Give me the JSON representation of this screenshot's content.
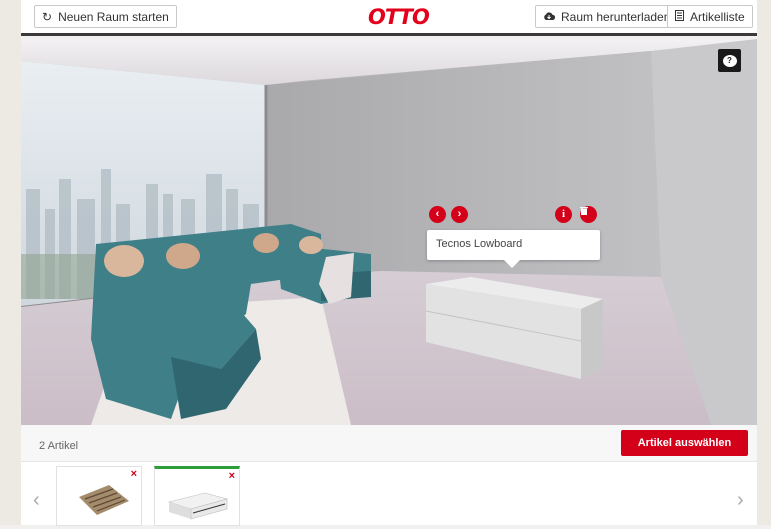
{
  "header": {
    "new_room_label": "Neuen Raum starten",
    "logo_text": "OTTO",
    "download_label": "Raum herunterladen",
    "article_list_label": "Artikelliste"
  },
  "scene": {
    "selected_item_name": "Tecnos Lowboard",
    "help_glyph": "?"
  },
  "bottom": {
    "article_count": "2 Artikel",
    "select_button_label": "Artikel auswählen",
    "items": [
      {
        "name": "rug-thumbnail",
        "remove_glyph": "×"
      },
      {
        "name": "lowboard-thumbnail",
        "remove_glyph": "×",
        "active": true
      }
    ]
  },
  "colors": {
    "brand_red": "#d40019",
    "active_green": "#2e9e3c",
    "header_bar": "#3a3a3a"
  }
}
